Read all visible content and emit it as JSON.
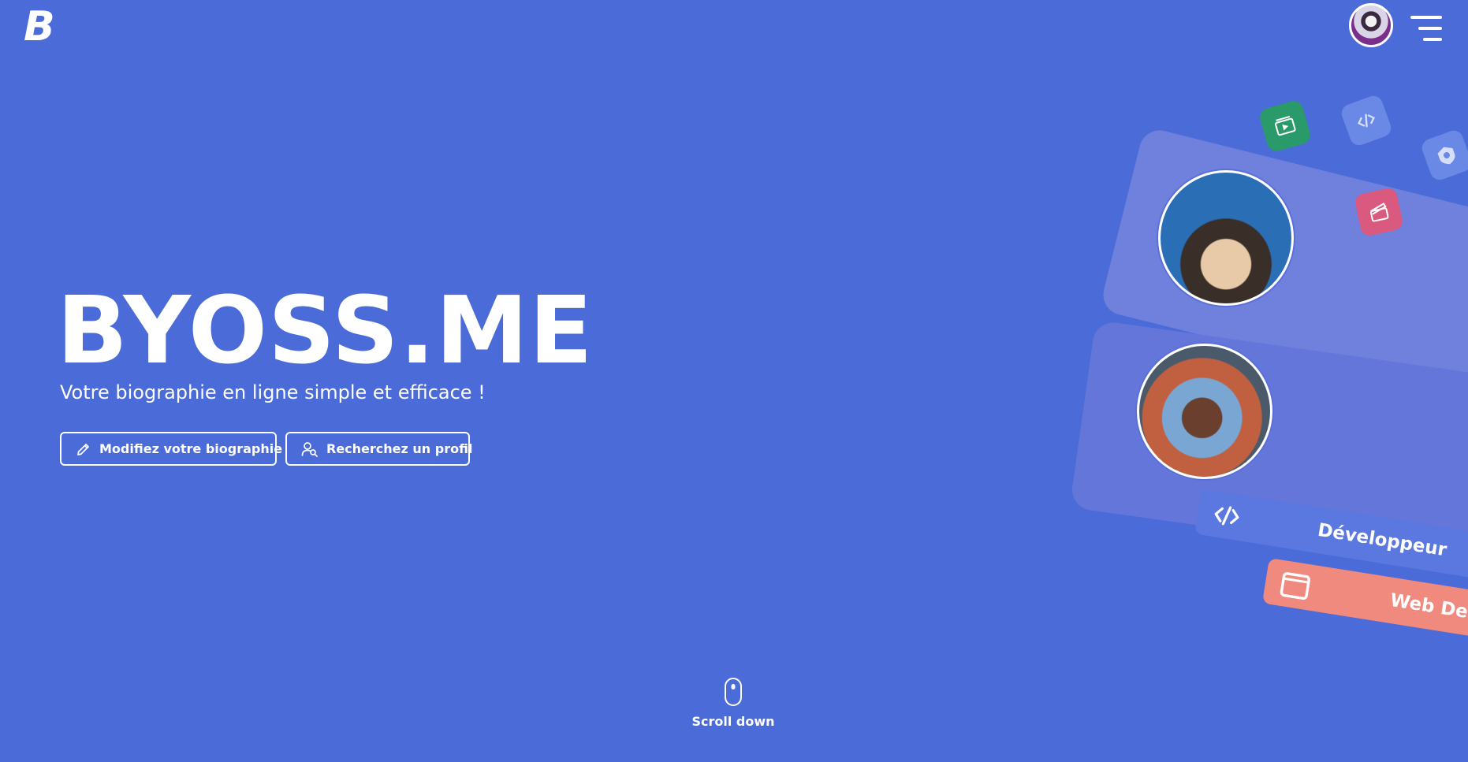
{
  "header": {
    "logo": "B",
    "avatar_label": "user-avatar",
    "menu_label": "menu"
  },
  "hero": {
    "title": "BYOSS.ME",
    "subtitle": "Votre biographie en ligne simple et efficace !",
    "buttons": [
      {
        "label": "Modifiez votre biographie",
        "icon": "pencil-icon"
      },
      {
        "label": "Recherchez un profil",
        "icon": "user-search-icon"
      }
    ]
  },
  "scroll": {
    "label": "Scroll down"
  },
  "illustration": {
    "tags": [
      {
        "label": "Développeur",
        "icon": "code-icon",
        "color": "#5a78e0"
      },
      {
        "label": "Web De",
        "icon": "window-icon",
        "color": "#f08a7e"
      }
    ],
    "chips": [
      {
        "icon": "video-icon",
        "color": "#2a9a6a"
      },
      {
        "icon": "code-icon",
        "color": "#6a88e6"
      },
      {
        "icon": "badge-icon",
        "color": "#6a88e6"
      },
      {
        "icon": "clapper-icon",
        "color": "#d95a7e"
      }
    ]
  },
  "colors": {
    "background": "#4a6bd8",
    "text": "#ffffff"
  }
}
